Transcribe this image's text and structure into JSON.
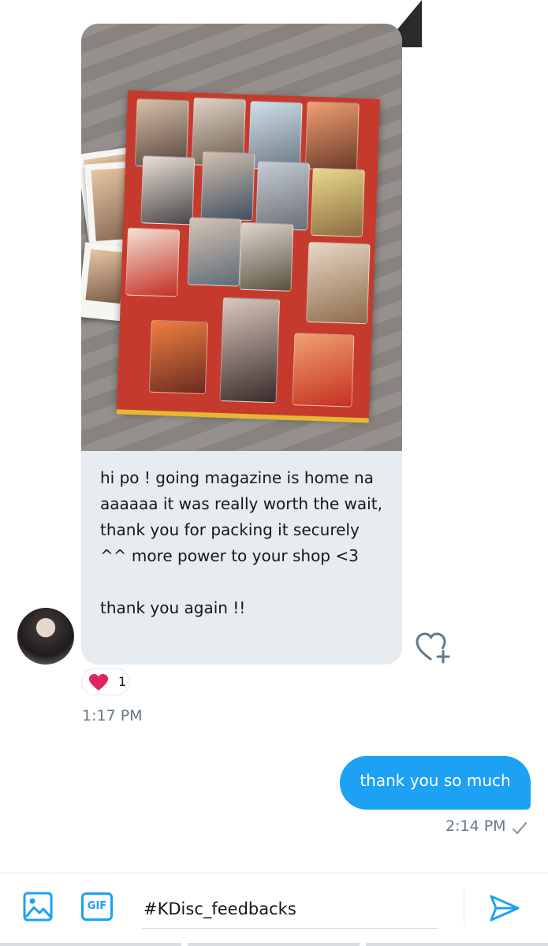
{
  "conversation": {
    "incoming": {
      "attachment_icon": "photo-attachment",
      "text": "hi po ! going magazine is home na aaaaaa it was really worth the wait, thank you for packing it securely ^^ more power to your shop <3\n\nthank you again !!",
      "reaction": {
        "icon": "heart-icon",
        "count": "1"
      },
      "time": "1:17 PM"
    },
    "outgoing": {
      "text": "thank you so much",
      "time": "2:14 PM",
      "status_icon": "check-icon"
    }
  },
  "composer": {
    "value": "#KDisc_feedbacks",
    "gif_label": "GIF"
  },
  "colors": {
    "accent": "#1da1f2",
    "incoming_bubble": "#e6ecf0",
    "heart": "#e0245e",
    "muted_text": "#657786"
  }
}
